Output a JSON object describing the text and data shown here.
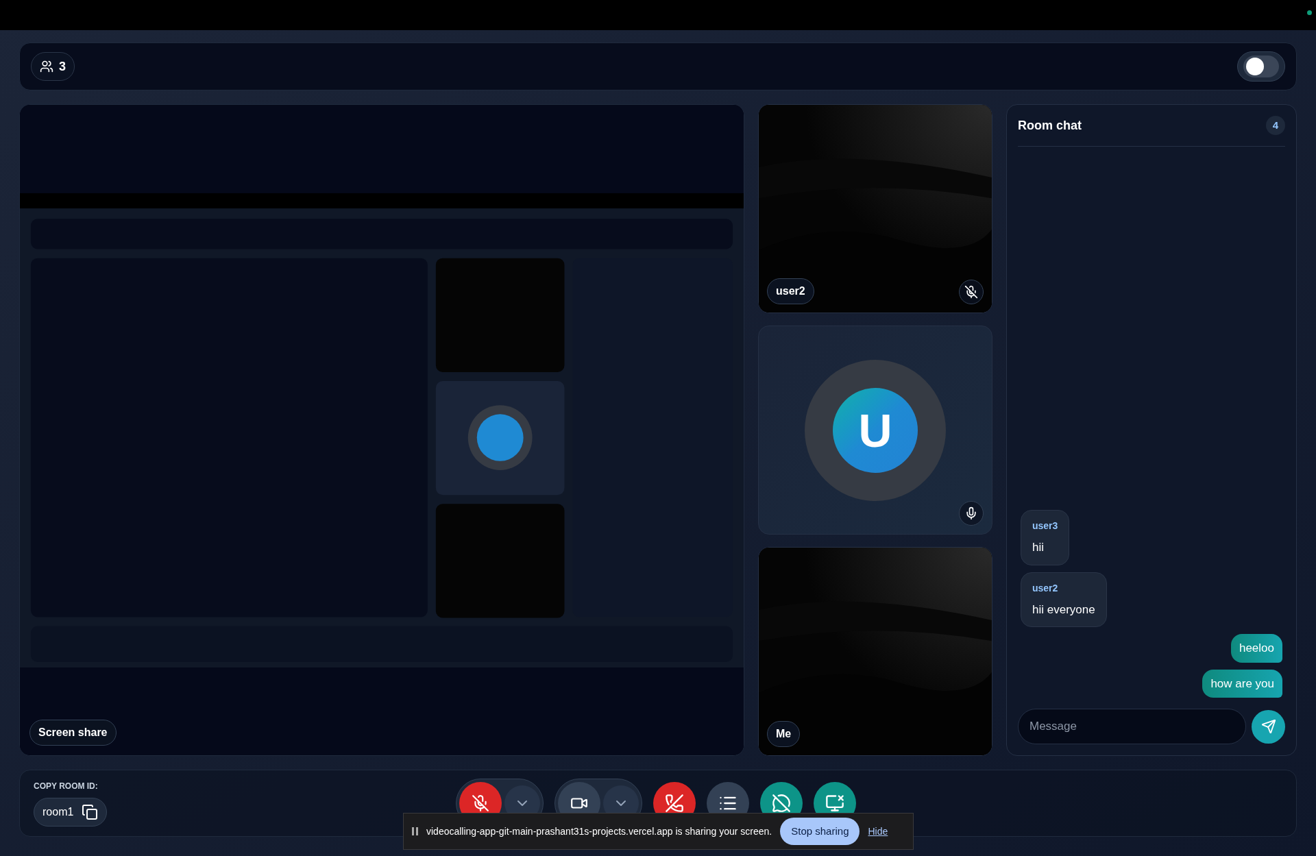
{
  "header": {
    "participants": "3",
    "theme_toggle": {
      "on": false
    }
  },
  "screen_share": {
    "label": "Screen share",
    "kind": "picture"
  },
  "tiles": [
    {
      "kind": "video",
      "name": "user2",
      "muted": true
    },
    {
      "kind": "avatar",
      "initial": "U",
      "muted": false
    },
    {
      "kind": "video",
      "name": "Me"
    }
  ],
  "chat": {
    "title": "Room chat",
    "count": "4",
    "messages": [
      {
        "author": "user3",
        "text": "hii",
        "own": false
      },
      {
        "author": "user2",
        "text": "hii everyone",
        "own": false
      },
      {
        "text": "heeloo",
        "own": true
      },
      {
        "text": "how are you",
        "own": true
      }
    ],
    "placeholder": "Message"
  },
  "room": {
    "label": "COPY ROOM ID:",
    "id": "room1"
  },
  "controls": [
    {
      "kind": "mic",
      "on": false
    },
    {
      "kind": "camera",
      "on": true
    },
    {
      "kind": "end"
    },
    {
      "kind": "list"
    },
    {
      "kind": "chat",
      "on": false
    },
    {
      "kind": "share",
      "on": true
    }
  ],
  "share_banner": {
    "text": "videocalling-app-git-main-prashant31s-projects.vercel.app is sharing your screen.",
    "stop": "Stop sharing",
    "hide": "Hide"
  }
}
